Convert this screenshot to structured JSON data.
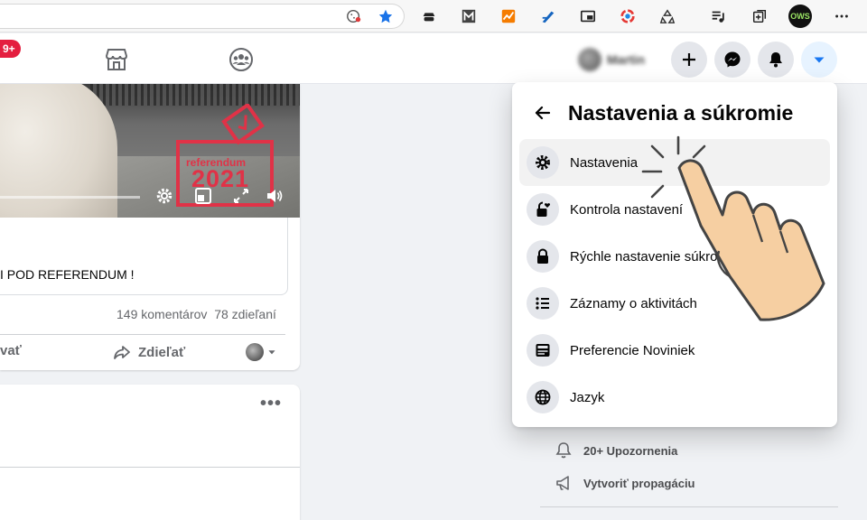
{
  "header": {
    "notification_badge": "9+",
    "profile_name": "Martin"
  },
  "post": {
    "video_logo_text1": "referendum",
    "video_logo_text2": "2021",
    "text": "I POD REFERENDUM !",
    "comments": "149 komentárov",
    "shares": "78 zdieľaní",
    "comment_action_partial": "vať",
    "share_action": "Zdieľať"
  },
  "panel": {
    "title": "Nastavenia a súkromie",
    "items": [
      {
        "label": "Nastavenia",
        "icon": "gear-icon"
      },
      {
        "label": "Kontrola nastavení",
        "icon": "lock-heart-icon"
      },
      {
        "label": "Rýchle nastavenie súkromia",
        "icon": "lock-icon"
      },
      {
        "label": "Záznamy o aktivitách",
        "icon": "list-icon"
      },
      {
        "label": "Preferencie Noviniek",
        "icon": "news-feed-icon"
      },
      {
        "label": "Jazyk",
        "icon": "globe-icon"
      }
    ]
  },
  "right_column": {
    "notifications": "20+ Upozornenia",
    "create_ad": "Vytvoriť propagáciu"
  },
  "browser": {
    "extension_label": "OWS"
  },
  "colors": {
    "facebook_blue": "#1877f2",
    "badge_red": "#e41e3f",
    "referendum_red": "#e03247"
  }
}
